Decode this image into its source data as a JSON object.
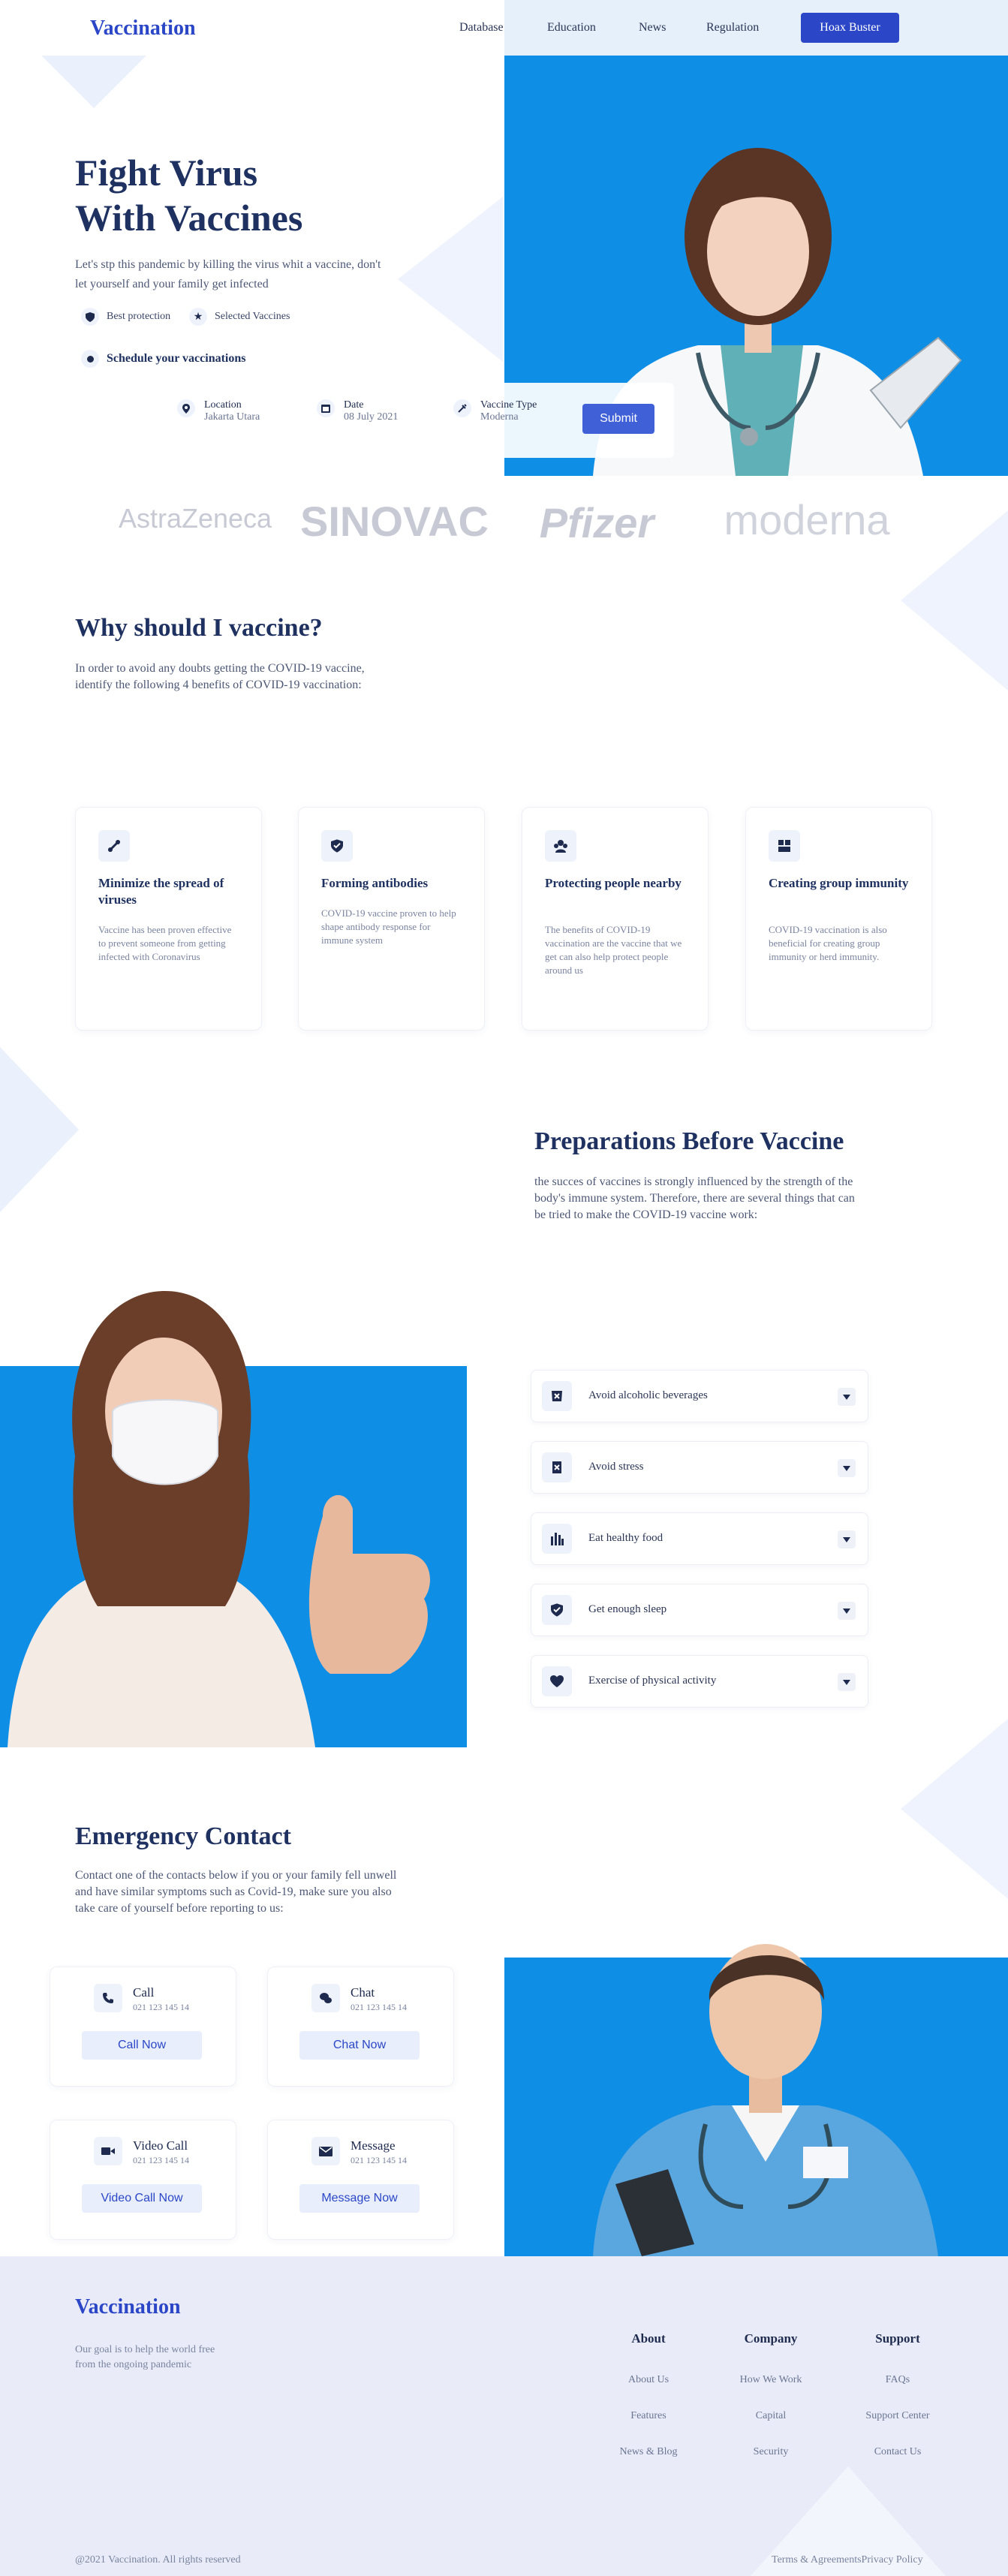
{
  "nav": {
    "logo": "Vaccination",
    "links": [
      "Database",
      "Education",
      "News",
      "Regulation"
    ],
    "cta": "Hoax Buster"
  },
  "hero": {
    "title_line1": "Fight Virus",
    "title_line2": "With Vaccines",
    "subtitle": "Let's stp this pandemic by killing the virus whit a vaccine, don't let yourself and your family get infected",
    "badge1": "Best protection",
    "badge2": "Selected Vaccines",
    "schedule": "Schedule your vaccinations",
    "form": {
      "location_label": "Location",
      "location_value": "Jakarta Utara",
      "date_label": "Date",
      "date_value": "08 July 2021",
      "type_label": "Vaccine Type",
      "type_value": "Moderna",
      "submit": "Submit"
    }
  },
  "brands": [
    "AstraZeneca",
    "SINOVAC",
    "Pfizer",
    "moderna"
  ],
  "why": {
    "title": "Why should I vaccine?",
    "text": "In order to avoid any doubts getting the COVID-19 vaccine, identify the following 4 benefits of COVID-19 vaccination:",
    "cards": [
      {
        "title": "Minimize the spread of viruses",
        "text": "Vaccine has been proven effective to prevent someone from getting infected with Coronavirus"
      },
      {
        "title": "Forming antibodies",
        "text": "COVID-19 vaccine proven to help shape antibody response for immune system"
      },
      {
        "title": "Protecting people nearby",
        "text": "The benefits of COVID-19 vaccination are the vaccine that we get can also help protect people around us"
      },
      {
        "title": "Creating group immunity",
        "text": "COVID-19 vaccination is also beneficial for creating group immunity or herd immunity."
      }
    ]
  },
  "prep": {
    "title": "Preparations Before Vaccine",
    "text": "the succes of vaccines is strongly influenced by the strength of the body's immune system. Therefore, there are several things that can be tried to make the COVID-19 vaccine work:",
    "items": [
      "Avoid alcoholic beverages",
      "Avoid stress",
      "Eat healthy food",
      "Get enough sleep",
      "Exercise of physical activity"
    ]
  },
  "emergency": {
    "title": "Emergency Contact",
    "text": "Contact one of the contacts below if you or your family fell unwell and have similar symptoms such as Covid-19, make sure you also take care of yourself before reporting to us:",
    "contacts": [
      {
        "title": "Call",
        "phone": "021 123 145 14",
        "button": "Call Now"
      },
      {
        "title": "Chat",
        "phone": "021 123 145 14",
        "button": "Chat Now"
      },
      {
        "title": "Video Call",
        "phone": "021 123 145 14",
        "button": "Video Call Now"
      },
      {
        "title": "Message",
        "phone": "021 123 145 14",
        "button": "Message Now"
      }
    ]
  },
  "footer": {
    "logo": "Vaccination",
    "tagline": "Our goal is to help the world free from the ongoing pandemic",
    "columns": [
      {
        "title": "About",
        "links": [
          "About Us",
          "Features",
          "News & Blog"
        ]
      },
      {
        "title": "Company",
        "links": [
          "How We Work",
          "Capital",
          "Security"
        ]
      },
      {
        "title": "Support",
        "links": [
          "FAQs",
          "Support Center",
          "Contact Us"
        ]
      }
    ],
    "copyright": "@2021 Vaccination. All rights reserved",
    "terms": "Terms & Agreements",
    "privacy": "Privacy Policy"
  },
  "colors": {
    "accent": "#2b47c7",
    "photo_bg": "#0f8ee6",
    "navy": "#1e3160",
    "footer_bg": "#e9ecf8"
  }
}
